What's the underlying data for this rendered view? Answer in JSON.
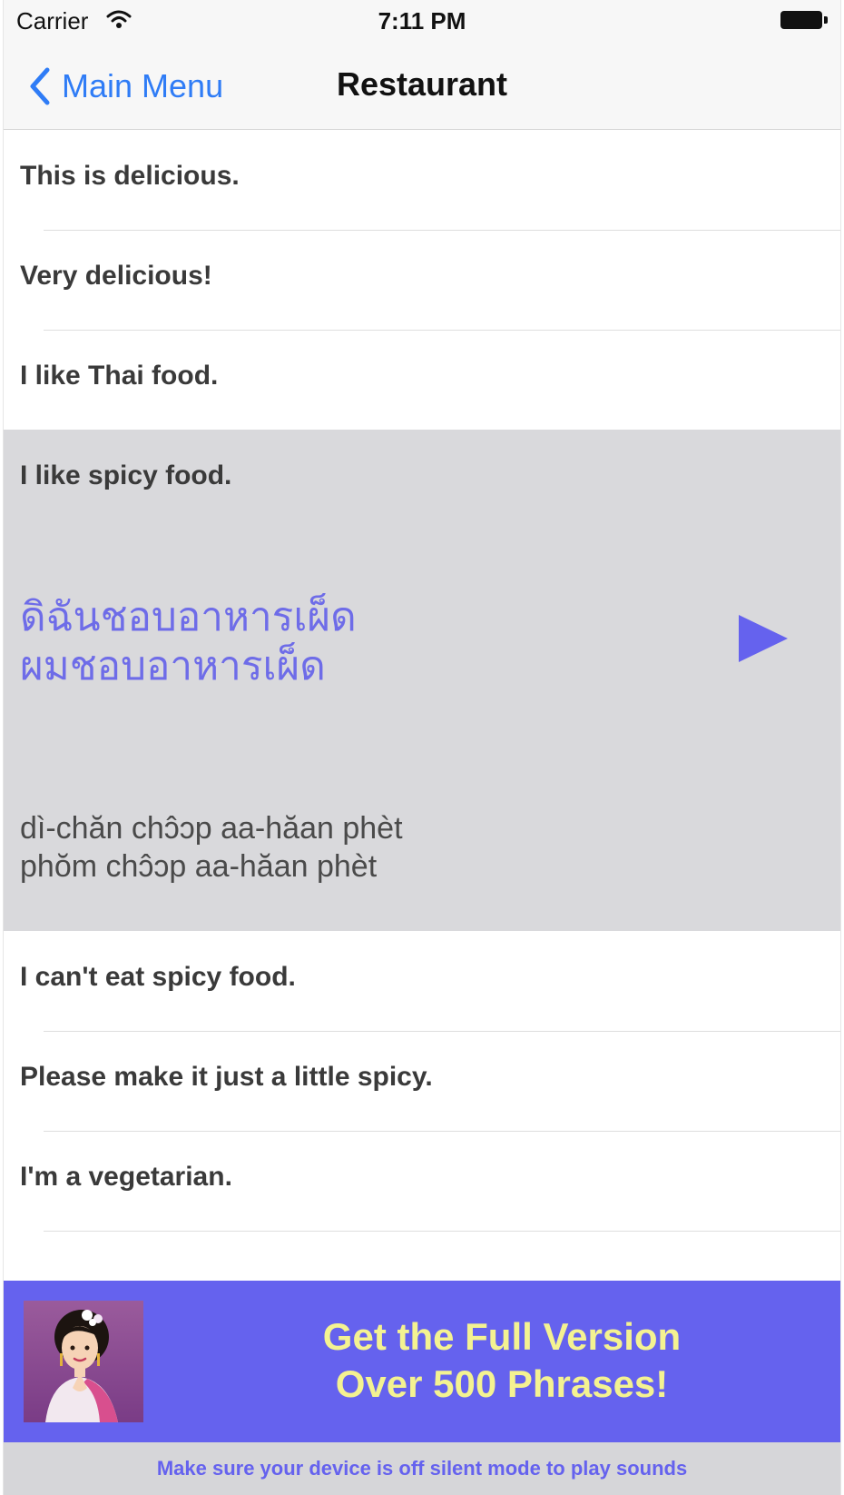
{
  "status_bar": {
    "carrier": "Carrier",
    "time": "7:11 PM",
    "wifi_icon": "wifi-icon",
    "battery_icon": "battery-icon"
  },
  "nav": {
    "back_label": "Main Menu",
    "back_icon": "chevron-left-icon",
    "title": "Restaurant",
    "accent_color": "#2f7cf6"
  },
  "phrases": {
    "items": [
      {
        "label": "This is delicious."
      },
      {
        "label": "Very delicious!"
      },
      {
        "label": "I like Thai food."
      }
    ],
    "expanded": {
      "label": "I like spicy food.",
      "thai_line1": "ดิฉันชอบอาหารเผ็ด",
      "thai_line2": "ผมชอบอาหารเผ็ด",
      "roman_line1": "dì-chăn chɔ̂ɔp aa-hăan phèt",
      "roman_line2": "phŏm chɔ̂ɔp aa-hăan phèt",
      "play_icon": "play-icon",
      "background": "#d9d9dc",
      "thai_color": "#6e6ce8"
    },
    "items_after": [
      {
        "label": "I can't eat spicy food."
      },
      {
        "label": "Please make it just a little spicy."
      },
      {
        "label": "I'm a vegetarian."
      }
    ]
  },
  "banner": {
    "line1": "Get the Full Version",
    "line2": "Over 500 Phrases!",
    "background": "#6562ee",
    "text_color": "#f4f291"
  },
  "footer": {
    "text": "Make sure your device is off silent mode to play sounds"
  }
}
